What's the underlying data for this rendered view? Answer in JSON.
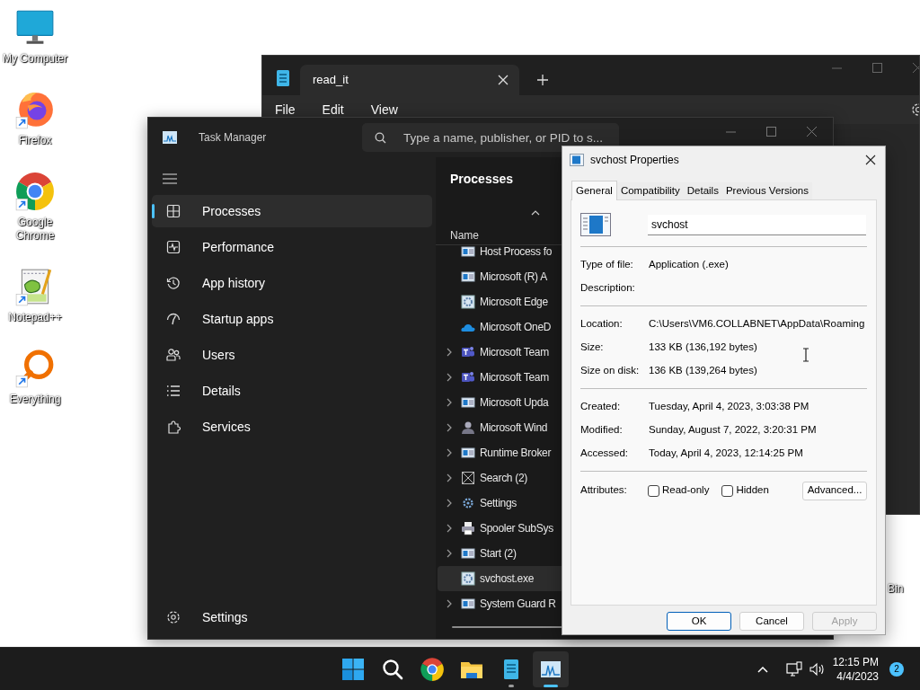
{
  "desktop_icons": [
    {
      "label": "My Computer",
      "kind": "monitor",
      "shortcut": false
    },
    {
      "label": "Firefox",
      "kind": "firefox",
      "shortcut": true
    },
    {
      "label": "Google Chrome",
      "kind": "chrome",
      "shortcut": true
    },
    {
      "label": "Notepad++",
      "kind": "notepadpp",
      "shortcut": true
    },
    {
      "label": "Everything",
      "kind": "everything",
      "shortcut": true
    }
  ],
  "recycle_bin_label": "Bin",
  "notepad": {
    "tab_title": "read_it",
    "menu": [
      "File",
      "Edit",
      "View"
    ]
  },
  "task_manager": {
    "title": "Task Manager",
    "search_placeholder": "Type a name, publisher, or PID to s...",
    "nav": [
      {
        "label": "Processes",
        "kind": "processes",
        "selected": true
      },
      {
        "label": "Performance",
        "kind": "performance",
        "selected": false
      },
      {
        "label": "App history",
        "kind": "history",
        "selected": false
      },
      {
        "label": "Startup apps",
        "kind": "startup",
        "selected": false
      },
      {
        "label": "Users",
        "kind": "users",
        "selected": false
      },
      {
        "label": "Details",
        "kind": "details",
        "selected": false
      },
      {
        "label": "Services",
        "kind": "services",
        "selected": false
      }
    ],
    "settings_label": "Settings",
    "heading": "Processes",
    "column": "Name",
    "processes": [
      {
        "name": "Host Process fo",
        "kind": "window",
        "expandable": false,
        "selected": false
      },
      {
        "name": "Microsoft (R) A",
        "kind": "window",
        "expandable": false,
        "selected": false
      },
      {
        "name": "Microsoft Edge",
        "kind": "gearpage",
        "expandable": false,
        "selected": false
      },
      {
        "name": "Microsoft OneD",
        "kind": "cloud",
        "expandable": false,
        "selected": false
      },
      {
        "name": "Microsoft Team",
        "kind": "teams",
        "expandable": true,
        "selected": false
      },
      {
        "name": "Microsoft Team",
        "kind": "teams",
        "expandable": true,
        "selected": false
      },
      {
        "name": "Microsoft Upda",
        "kind": "window",
        "expandable": true,
        "selected": false
      },
      {
        "name": "Microsoft Wind",
        "kind": "person",
        "expandable": true,
        "selected": false
      },
      {
        "name": "Runtime Broker",
        "kind": "window",
        "expandable": true,
        "selected": false
      },
      {
        "name": "Search (2)",
        "kind": "crossbox",
        "expandable": true,
        "selected": false
      },
      {
        "name": "Settings",
        "kind": "gear",
        "expandable": true,
        "selected": false
      },
      {
        "name": "Spooler SubSys",
        "kind": "printer",
        "expandable": true,
        "selected": false
      },
      {
        "name": "Start (2)",
        "kind": "window",
        "expandable": true,
        "selected": false
      },
      {
        "name": "svchost.exe",
        "kind": "gearpage",
        "expandable": false,
        "selected": true
      },
      {
        "name": "System Guard R",
        "kind": "window",
        "expandable": true,
        "selected": false
      }
    ]
  },
  "properties_dialog": {
    "title": "svchost Properties",
    "tabs": [
      {
        "label": "General",
        "selected": true
      },
      {
        "label": "Compatibility",
        "selected": false
      },
      {
        "label": "Details",
        "selected": false
      },
      {
        "label": "Previous Versions",
        "selected": false
      }
    ],
    "file_name": "svchost",
    "sections": [
      [
        {
          "label": "Type of file:",
          "value": "Application (.exe)"
        },
        {
          "label": "Description:"
        }
      ],
      [
        {
          "label": "Location:",
          "value": "C:\\Users\\VM6.COLLABNET\\AppData\\Roaming"
        },
        {
          "label": "Size:",
          "value": "133 KB (136,192 bytes)"
        },
        {
          "label": "Size on disk:",
          "value": "136 KB (139,264 bytes)"
        }
      ],
      [
        {
          "label": "Created:",
          "value": "Tuesday, April 4, 2023, 3:03:38 PM"
        },
        {
          "label": "Modified:",
          "value": "Sunday, August 7, 2022, 3:20:31 PM"
        },
        {
          "label": "Accessed:",
          "value": "Today, April 4, 2023, 12:14:25 PM"
        }
      ]
    ],
    "attributes_label": "Attributes:",
    "attributes": [
      {
        "label": "Read-only",
        "checked": false
      },
      {
        "label": "Hidden",
        "checked": false
      }
    ],
    "advanced_button": "Advanced...",
    "buttons": [
      {
        "label": "OK",
        "kind": "default",
        "disabled": false
      },
      {
        "label": "Cancel",
        "kind": "normal",
        "disabled": false
      },
      {
        "label": "Apply",
        "kind": "normal",
        "disabled": true
      }
    ]
  },
  "taskbar": {
    "apps": [
      {
        "kind": "start",
        "running": false,
        "active": false
      },
      {
        "kind": "search",
        "running": false,
        "active": false
      },
      {
        "kind": "chrome",
        "running": false,
        "active": false
      },
      {
        "kind": "folder",
        "running": false,
        "active": false
      },
      {
        "kind": "notepad",
        "running": true,
        "active": false
      },
      {
        "kind": "taskmanager",
        "running": true,
        "active": true
      }
    ],
    "time": "12:15 PM",
    "date": "4/4/2023",
    "notification_count": "2"
  }
}
